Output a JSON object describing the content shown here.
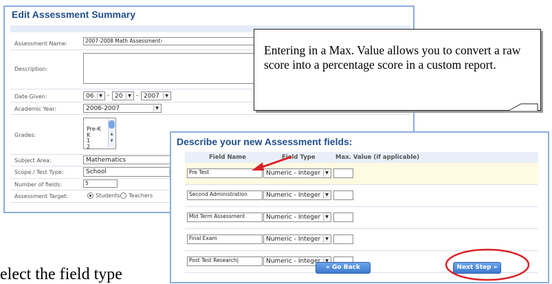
{
  "summary": {
    "title": "Edit Assessment Summary",
    "labels": {
      "name": "Assessment Name:",
      "description": "Description:",
      "date_given": "Date Given:",
      "academic_year": "Academic Year:",
      "grades": "Grades:",
      "subject_area": "Subject Area:",
      "scope": "Scope / Test Type:",
      "num_fields": "Number of fields:",
      "target": "Assessment Target:"
    },
    "name_value": "2007-2008 Math Assessment›",
    "date": {
      "month": "06",
      "day": "20",
      "year": "2007",
      "sep": "-"
    },
    "academic_year": "2006-2007",
    "grades": [
      "Pre-K",
      "K",
      "1",
      "2"
    ],
    "subject_area": "Mathematics",
    "scope": "School",
    "num_fields": "5",
    "target_options": {
      "students": "Students",
      "teachers": "Teachers",
      "selected": "Students"
    }
  },
  "callout": {
    "text": "Entering in a Max. Value allows you to convert a raw score into a percentage score in a custom report."
  },
  "fields": {
    "title": "Describe your new Assessment fields:",
    "headers": {
      "name": "Field Name",
      "type": "Field Type",
      "max": "Max. Value (if applicable)"
    },
    "rows": [
      {
        "name": "Pre Test",
        "type": "Numeric - Integer",
        "max": ""
      },
      {
        "name": "Second Administration",
        "type": "Numeric - Integer",
        "max": ""
      },
      {
        "name": "Mid Term Assessment",
        "type": "Numeric - Integer",
        "max": ""
      },
      {
        "name": "Final Exam",
        "type": "Numeric - Integer",
        "max": ""
      },
      {
        "name": "Post Test Research|",
        "type": "Numeric - Integer",
        "max": ""
      }
    ],
    "go_back": "Go Back",
    "next_step": "Next Step",
    "go_back_icon": "«",
    "next_step_icon": "»"
  },
  "icons": {
    "dropdown": "▼",
    "list_up": "▲",
    "list_down": "▼"
  },
  "colors": {
    "accent": "#1f4e8c",
    "border": "#8aaee0",
    "highlight": "#d9232a"
  },
  "bottom_text": "elect the field type"
}
